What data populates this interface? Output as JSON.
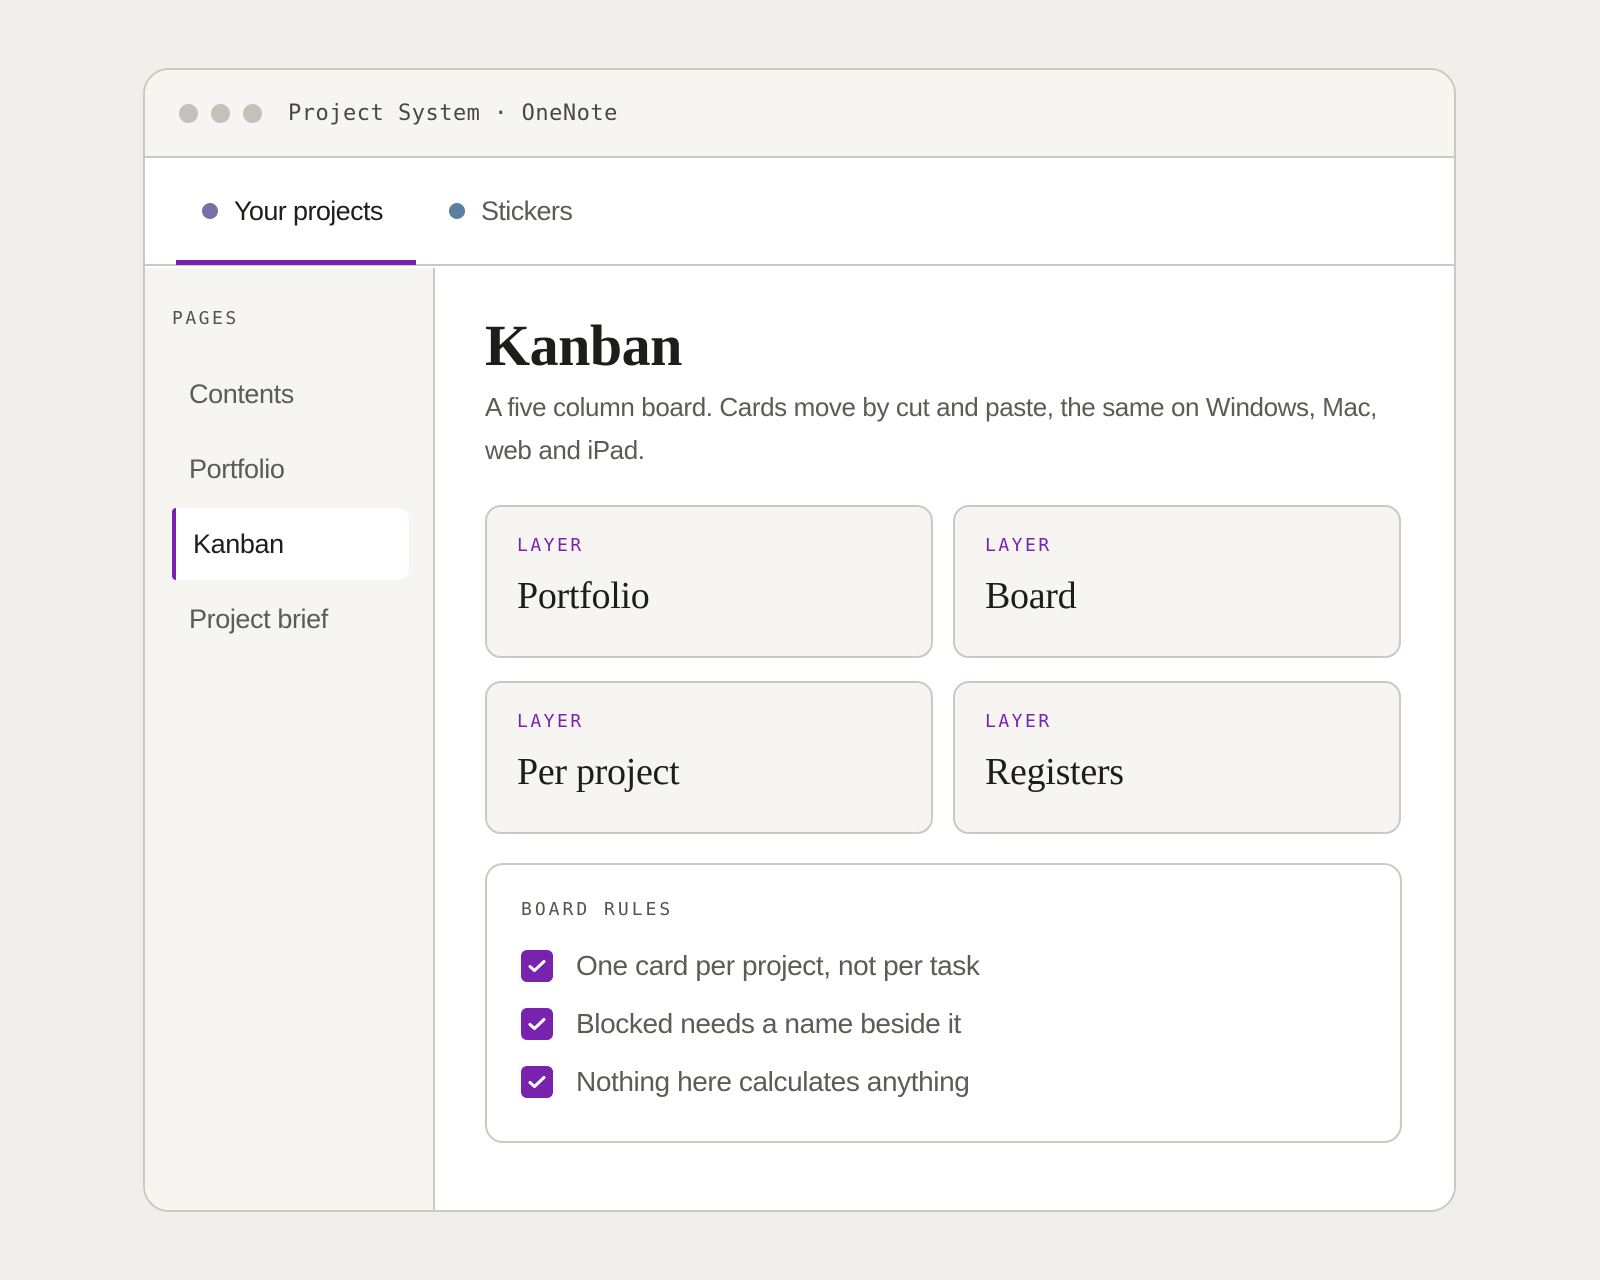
{
  "window": {
    "title": "Project System · OneNote"
  },
  "tabs": [
    {
      "label": "Your projects",
      "dot_color": "#7b6fa8",
      "active": true
    },
    {
      "label": "Stickers",
      "dot_color": "#5b7ea3",
      "active": false
    }
  ],
  "sidebar": {
    "section_label": "PAGES",
    "items": [
      {
        "label": "Contents"
      },
      {
        "label": "Portfolio"
      },
      {
        "label": "Kanban",
        "active": true
      },
      {
        "label": "Project brief"
      }
    ]
  },
  "page": {
    "title": "Kanban",
    "description": "A five column board. Cards move by cut and paste, the same on Windows, Mac, web and iPad."
  },
  "cards": [
    {
      "kicker": "LAYER",
      "title": "Portfolio"
    },
    {
      "kicker": "LAYER",
      "title": "Board"
    },
    {
      "kicker": "LAYER",
      "title": "Per project"
    },
    {
      "kicker": "LAYER",
      "title": "Registers"
    }
  ],
  "board_rules": {
    "label": "BOARD RULES",
    "items": [
      {
        "text": "One card per project, not per task",
        "checked": true
      },
      {
        "text": "Blocked needs a name beside it",
        "checked": true
      },
      {
        "text": "Nothing here calculates anything",
        "checked": true
      }
    ]
  },
  "colors": {
    "accent": "#7a22b0",
    "border": "#cbc9c2",
    "panel": "#f6f5f1",
    "background": "#f0efeb"
  }
}
